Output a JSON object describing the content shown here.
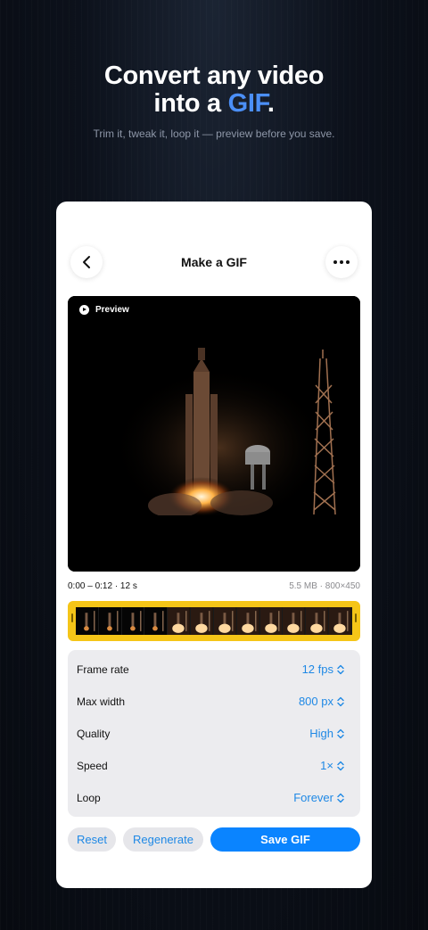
{
  "hero": {
    "title_line1": "Convert any video",
    "title_line2_prefix": "into a ",
    "title_accent": "GIF",
    "title_suffix": ".",
    "subtitle": "Trim it, tweak it, loop it — preview before you save."
  },
  "nav": {
    "title": "Make a GIF",
    "back_icon": "chevron-left-icon",
    "more_icon": "ellipsis-icon"
  },
  "preview": {
    "label": "Preview",
    "icon": "play-icon"
  },
  "clip": {
    "range": "0:00 – 0:12 · 12 s",
    "info": "5.5 MB · 800×450"
  },
  "timeline": {
    "frame_count": 12
  },
  "settings": {
    "rows": [
      {
        "label": "Frame rate",
        "value": "12 fps"
      },
      {
        "label": "Max width",
        "value": "800 px"
      },
      {
        "label": "Quality",
        "value": "High"
      },
      {
        "label": "Speed",
        "value": "1×"
      },
      {
        "label": "Loop",
        "value": "Forever"
      }
    ]
  },
  "actions": {
    "reset": "Reset",
    "regenerate": "Regenerate",
    "save": "Save GIF"
  },
  "colors": {
    "accent": "#4b8ff7",
    "primary_button": "#0a84ff",
    "link": "#1e88e5",
    "timeline_border": "#f5c518"
  }
}
